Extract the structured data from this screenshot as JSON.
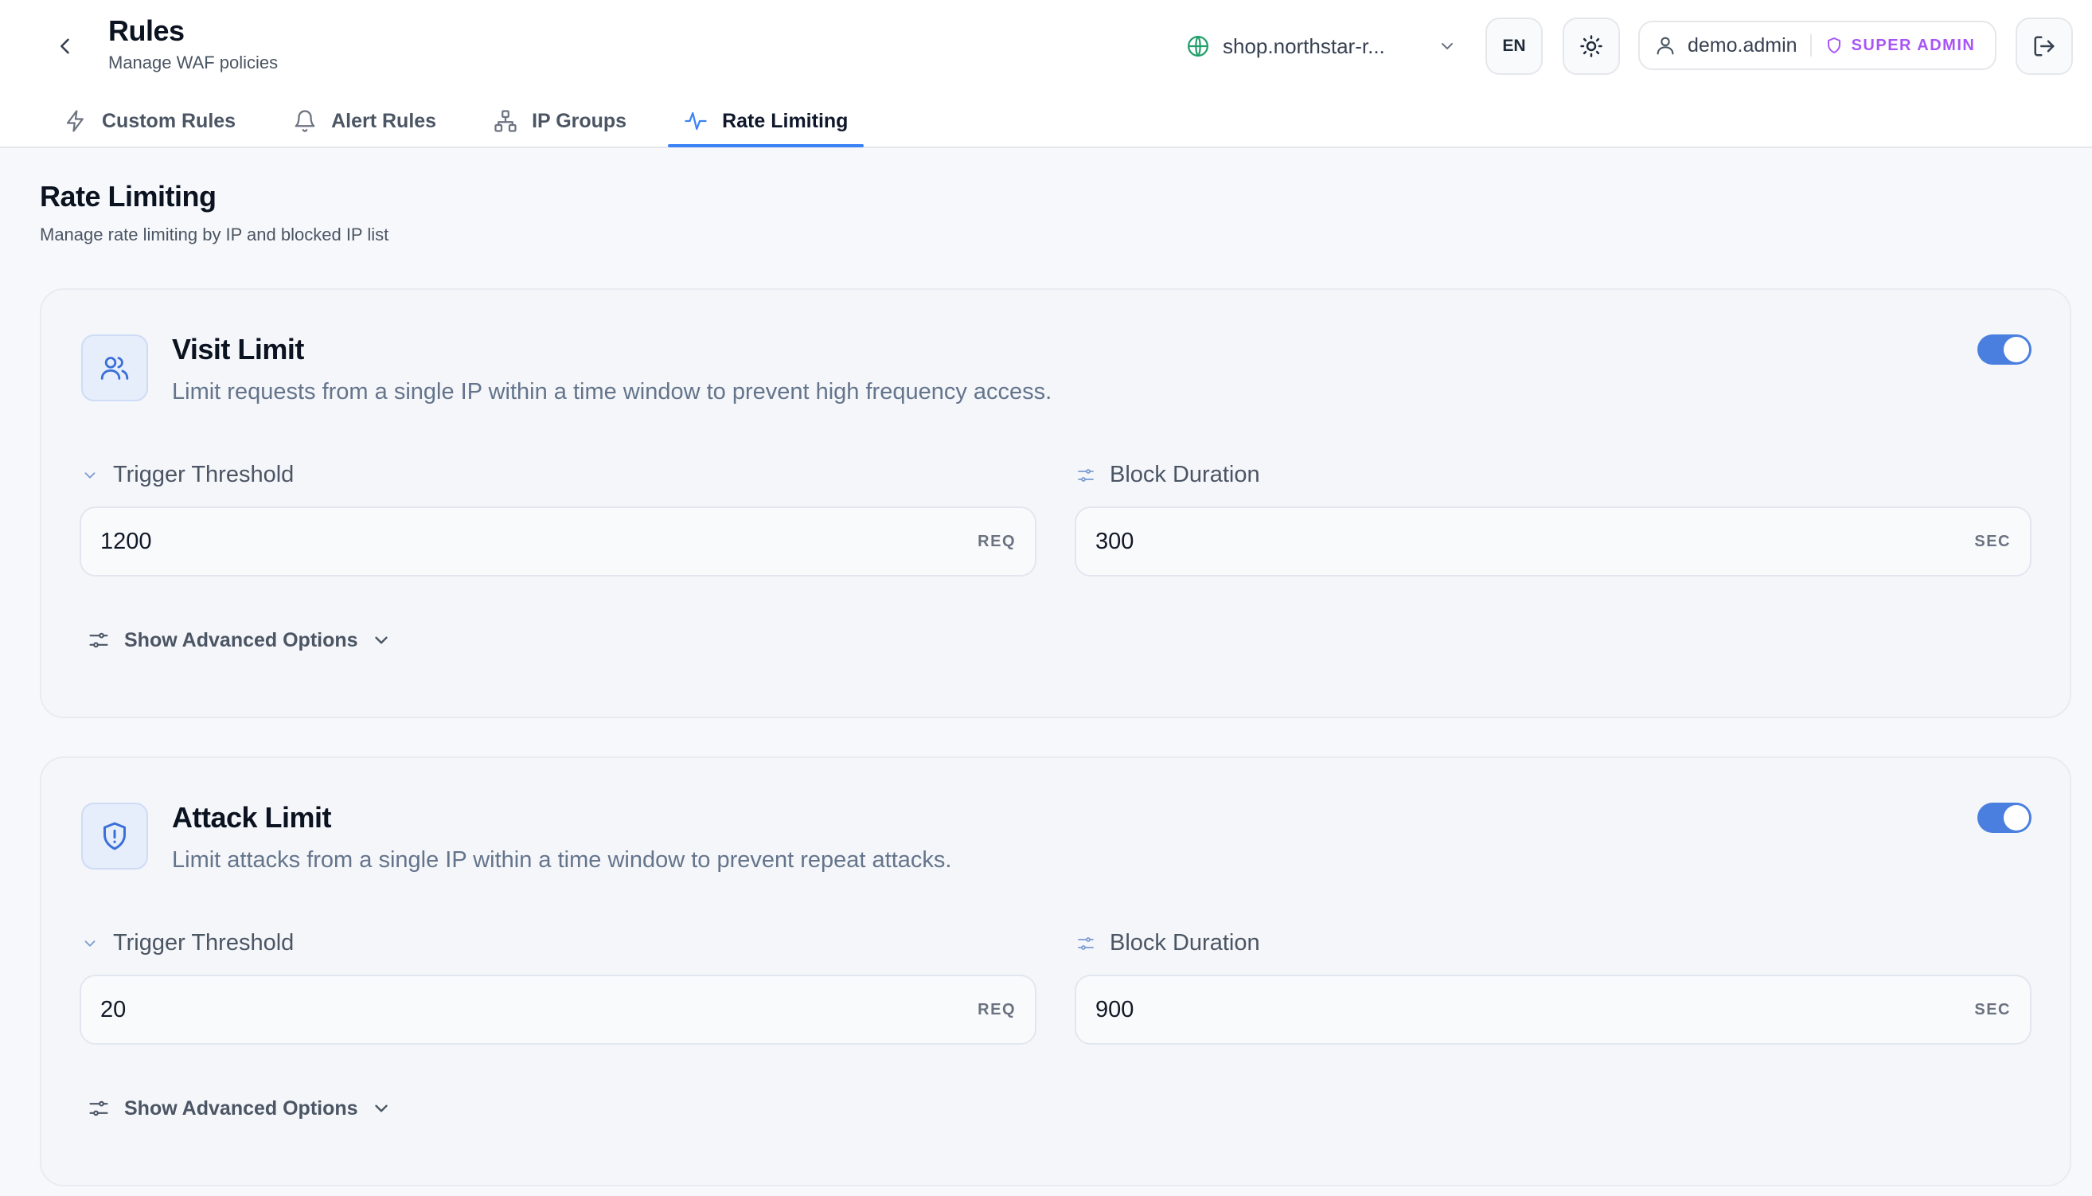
{
  "header": {
    "title": "Rules",
    "subtitle": "Manage WAF policies",
    "domain": "shop.northstar-r...",
    "language": "EN",
    "user": "demo.admin",
    "role": "SUPER ADMIN"
  },
  "tabs": [
    {
      "label": "Custom Rules",
      "icon": "zap-icon",
      "active": false
    },
    {
      "label": "Alert Rules",
      "icon": "bell-icon",
      "active": false
    },
    {
      "label": "IP Groups",
      "icon": "network-icon",
      "active": false
    },
    {
      "label": "Rate Limiting",
      "icon": "activity-icon",
      "active": true
    }
  ],
  "section": {
    "title": "Rate Limiting",
    "subtitle": "Manage rate limiting by IP and blocked IP list"
  },
  "cards": [
    {
      "title": "Visit Limit",
      "description": "Limit requests from a single IP within a time window to prevent high frequency access.",
      "icon": "users-icon",
      "enabled": true,
      "threshold_label": "Trigger Threshold",
      "threshold_value": "1200",
      "threshold_unit": "REQ",
      "duration_label": "Block Duration",
      "duration_value": "300",
      "duration_unit": "SEC",
      "advanced_label": "Show Advanced Options"
    },
    {
      "title": "Attack Limit",
      "description": "Limit attacks from a single IP within a time window to prevent repeat attacks.",
      "icon": "shield-alert-icon",
      "enabled": true,
      "threshold_label": "Trigger Threshold",
      "threshold_value": "20",
      "threshold_unit": "REQ",
      "duration_label": "Block Duration",
      "duration_value": "900",
      "duration_unit": "SEC",
      "advanced_label": "Show Advanced Options"
    }
  ],
  "colors": {
    "accent": "#3b82f6",
    "toggle_on": "#4a7fe0",
    "role_badge": "#a855f7",
    "globe": "#22a06b"
  }
}
